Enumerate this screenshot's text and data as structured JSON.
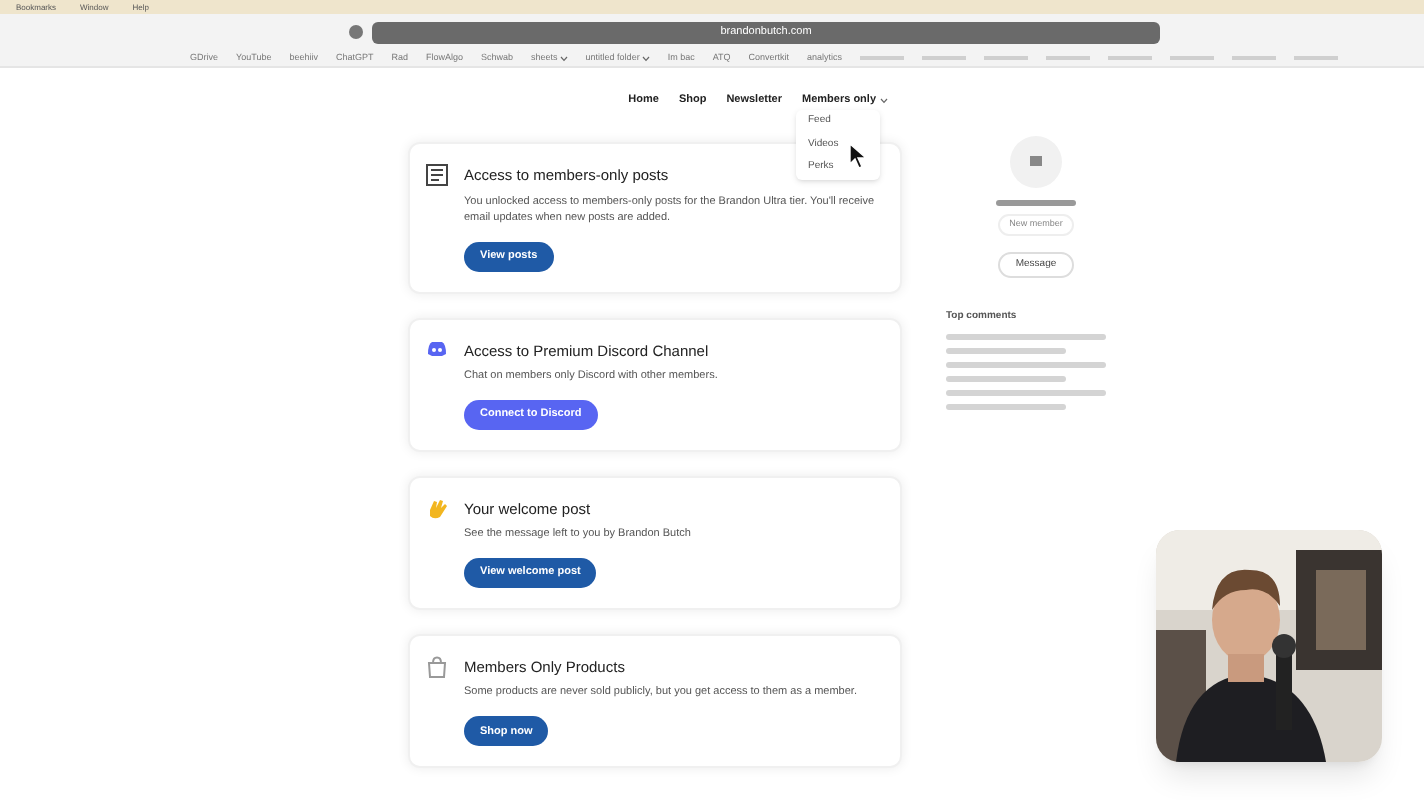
{
  "menu_bar": [
    "Bookmarks",
    "Window",
    "Help"
  ],
  "address_bar": {
    "url": "brandonbutch.com"
  },
  "bookmarks": [
    {
      "label": "GDrive",
      "folder": false
    },
    {
      "label": "YouTube",
      "folder": false
    },
    {
      "label": "beehiiv",
      "folder": false
    },
    {
      "label": "ChatGPT",
      "folder": false
    },
    {
      "label": "Rad",
      "folder": false
    },
    {
      "label": "FlowAlgo",
      "folder": false
    },
    {
      "label": "Schwab",
      "folder": false
    },
    {
      "label": "sheets",
      "folder": true
    },
    {
      "label": "untitled folder",
      "folder": true
    },
    {
      "label": "Im bac",
      "folder": false
    },
    {
      "label": "ATQ",
      "folder": false
    },
    {
      "label": "Convertkit",
      "folder": false
    },
    {
      "label": "analytics",
      "folder": false
    }
  ],
  "nav": [
    {
      "label": "Home",
      "expanded": false
    },
    {
      "label": "Shop",
      "expanded": false
    },
    {
      "label": "Newsletter",
      "expanded": false
    },
    {
      "label": "Members only",
      "expanded": true
    }
  ],
  "dropdown": [
    "Feed",
    "Videos",
    "Perks"
  ],
  "cards": [
    {
      "kind": "posts",
      "title": "Access to members-only posts",
      "text": "You unlocked access to members-only posts for the Brandon Ultra tier. You'll receive email updates when new posts are added.",
      "button": "View posts"
    },
    {
      "kind": "discord",
      "title": "Access to Premium Discord Channel",
      "text": "Chat on members only Discord with other members.",
      "button": "Connect to Discord"
    },
    {
      "kind": "welcome",
      "title": "Your welcome post",
      "text": "See the message left to you by Brandon Butch",
      "button": "View welcome post"
    },
    {
      "kind": "products",
      "title": "Members Only Products",
      "text": "Some products are never sold publicly, but you get access to them as a member.",
      "button": "Shop now"
    }
  ],
  "profile": {
    "badge": "New member",
    "button": "Message"
  },
  "comments": {
    "title": "Top comments"
  }
}
